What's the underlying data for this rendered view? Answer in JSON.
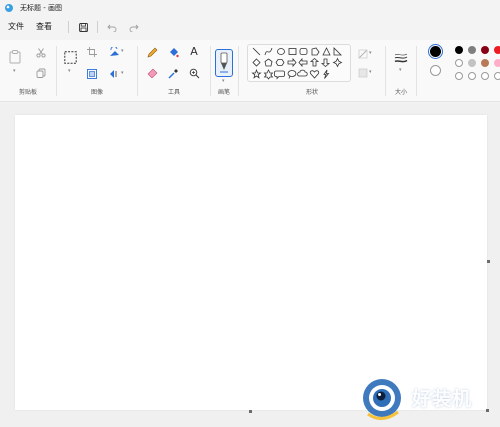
{
  "window": {
    "title": "无标题 - 画图"
  },
  "menu": {
    "file": "文件",
    "view": "查看"
  },
  "ribbon": {
    "groups": {
      "clipboard": "剪贴板",
      "image": "图像",
      "tools": "工具",
      "brushes": "画笔",
      "shapes": "形状",
      "size": "大小"
    },
    "text_tool_glyph": "A"
  },
  "colors": {
    "primary": "#000000",
    "secondary": "#ffffff",
    "palette_row1": [
      "#000000",
      "#7f7f7f",
      "#880015",
      "#ed1c24"
    ],
    "palette_row2": [
      "#ffffff",
      "#c3c3c3",
      "#b97a57",
      "#ffaec9"
    ],
    "accent": "#2c6fd6"
  },
  "watermark": {
    "text": "好装机"
  }
}
